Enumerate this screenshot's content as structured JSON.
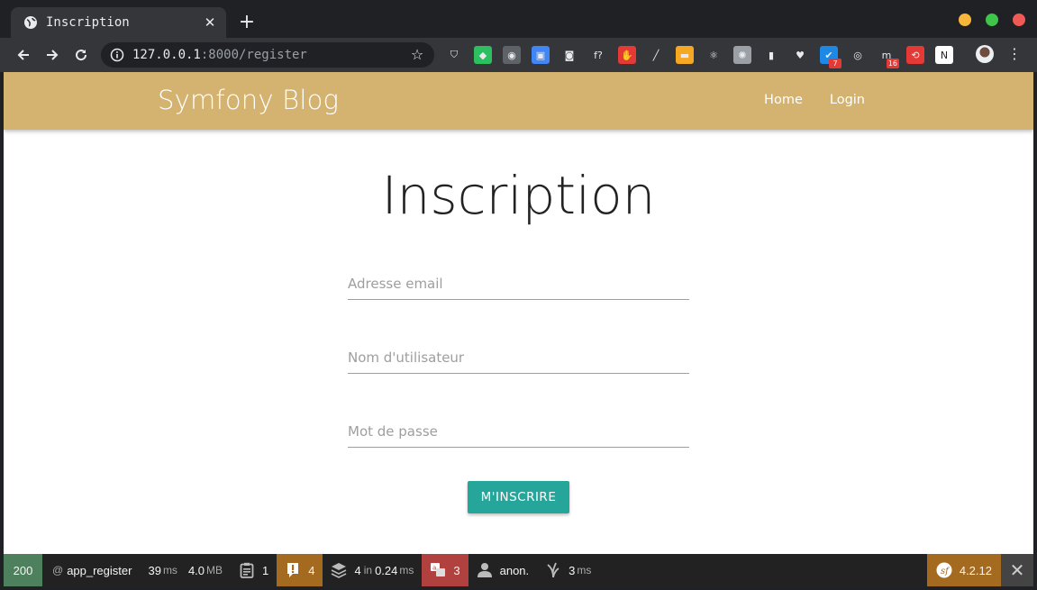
{
  "browser": {
    "tab_title": "Inscription",
    "tab_close": "✕",
    "new_tab": "+",
    "url_host": "127.0.0.1",
    "url_rest": ":8000/register",
    "traffic_colors": [
      "#f8b73a",
      "#3ec54a",
      "#f05a55"
    ],
    "extensions": [
      {
        "name": "pocket-icon",
        "glyph": "⛉",
        "color": "transparent",
        "badge": ""
      },
      {
        "name": "evernote-icon",
        "glyph": "◆",
        "color": "#2dbe60",
        "badge": ""
      },
      {
        "name": "keep-icon",
        "glyph": "◉",
        "color": "#5f6368",
        "badge": ""
      },
      {
        "name": "translate-icon",
        "glyph": "▣",
        "color": "#4285f4",
        "badge": ""
      },
      {
        "name": "camera-icon",
        "glyph": "◙",
        "color": "transparent",
        "badge": ""
      },
      {
        "name": "fonts-icon",
        "glyph": "f?",
        "color": "transparent",
        "badge": ""
      },
      {
        "name": "adblock-icon",
        "glyph": "✋",
        "color": "#e53935",
        "badge": ""
      },
      {
        "name": "color-picker-icon",
        "glyph": "╱",
        "color": "transparent",
        "badge": ""
      },
      {
        "name": "mail-icon",
        "glyph": "▬",
        "color": "#f7a823",
        "badge": ""
      },
      {
        "name": "react-icon",
        "glyph": "⚛",
        "color": "transparent",
        "badge": ""
      },
      {
        "name": "gear-icon",
        "glyph": "✺",
        "color": "#9aa0a6",
        "badge": ""
      },
      {
        "name": "palette-icon",
        "glyph": "▮",
        "color": "transparent",
        "badge": ""
      },
      {
        "name": "heart-icon",
        "glyph": "♥",
        "color": "transparent",
        "badge": ""
      },
      {
        "name": "todo-icon",
        "glyph": "✔",
        "color": "#1e88e5",
        "badge": "7"
      },
      {
        "name": "circle-icon",
        "glyph": "◎",
        "color": "transparent",
        "badge": ""
      },
      {
        "name": "m-icon",
        "glyph": "m",
        "color": "transparent",
        "badge": "16"
      },
      {
        "name": "refresh-red-icon",
        "glyph": "⟲",
        "color": "#e53935",
        "badge": ""
      },
      {
        "name": "notion-icon",
        "glyph": "N",
        "color": "#ffffff",
        "badge": ""
      }
    ]
  },
  "site": {
    "brand": "Symfony Blog",
    "nav": [
      "Home",
      "Login"
    ]
  },
  "form": {
    "title": "Inscription",
    "email_placeholder": "Adresse email",
    "username_placeholder": "Nom d'utilisateur",
    "password_placeholder": "Mot de passe",
    "submit_label": "M'INSCRIRE"
  },
  "debug_bar": {
    "status": "200",
    "route_prefix": "@",
    "route": "app_register",
    "time_value": "39",
    "time_unit": "ms",
    "memory_value": "4.0",
    "memory_unit": "MB",
    "forms_count": "1",
    "logs_count": "4",
    "cache_count": "4",
    "cache_in": "in",
    "cache_time": "0.24",
    "cache_unit": "ms",
    "translation_count": "3",
    "user": "anon.",
    "twig_value": "3",
    "twig_unit": "ms",
    "version": "4.2.12",
    "close": "✕"
  }
}
